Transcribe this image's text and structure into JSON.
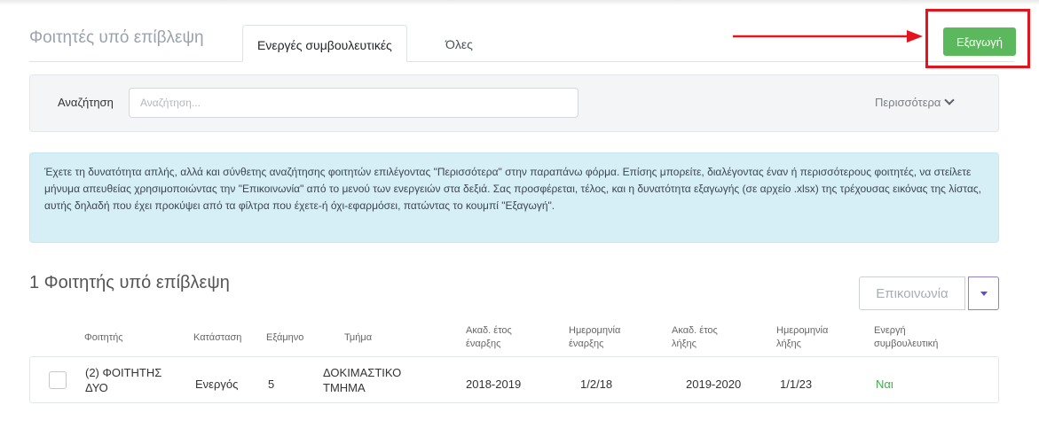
{
  "tabs": {
    "title": "Φοιτητές υπό επίβλεψη",
    "items": [
      {
        "label": "Ενεργές συμβουλευτικές",
        "active": true
      },
      {
        "label": "Όλες",
        "active": false
      }
    ]
  },
  "export": {
    "label": "Εξαγωγή",
    "color": "#5cb85c",
    "highlight_color": "#e3141b"
  },
  "search": {
    "label": "Αναζήτηση",
    "placeholder": "Αναζήτηση...",
    "value": "",
    "more_label": "Περισσότερα"
  },
  "info": {
    "text": "Έχετε τη δυνατότητα απλής, αλλά και σύνθετης αναζήτησης φοιτητών επιλέγοντας \"Περισσότερα\" στην παραπάνω φόρμα. Επίσης μπορείτε, διαλέγοντας έναν ή περισσότερους φοιτητές, να στείλετε μήνυμα απευθείας χρησιμοποιώντας την \"Επικοινωνία\" από το μενού των ενεργειών στα δεξιά. Σας προσφέρεται, τέλος, και η δυνατότητα εξαγωγής (σε αρχείο .xlsx) της τρέχουσας εικόνας της λίστας, αυτής δηλαδή που έχει προκύψει από τα φίλτρα που έχετε-ή όχι-εφαρμόσει, πατώντας το κουμπί \"Εξαγωγή\"."
  },
  "list": {
    "heading": "1 Φοιτητής υπό επίβλεψη",
    "contact_label": "Επικοινωνία",
    "columns": {
      "student": "Φοιτητής",
      "status": "Κατάσταση",
      "semester": "Εξάμηνο",
      "department": "Τμήμα",
      "start_year_1": "Ακαδ. έτος",
      "start_year_2": "έναρξης",
      "start_date_1": "Ημερομηνία",
      "start_date_2": "έναρξης",
      "end_year_1": "Ακαδ. έτος",
      "end_year_2": "λήξης",
      "end_date_1": "Ημερομηνία",
      "end_date_2": "λήξης",
      "active_1": "Ενεργή",
      "active_2": "συμβουλευτική"
    },
    "rows": [
      {
        "student_1": "(2) ΦΟΙΤΗΤΗΣ",
        "student_2": "ΔΥΟ",
        "status": "Ενεργός",
        "semester": "5",
        "department_1": "ΔΟΚΙΜΑΣΤΙΚΟ",
        "department_2": "ΤΜΗΜΑ",
        "start_year": "2018-2019",
        "start_date": "1/2/18",
        "end_year": "2019-2020",
        "end_date": "1/1/23",
        "active": "Ναι"
      }
    ]
  }
}
